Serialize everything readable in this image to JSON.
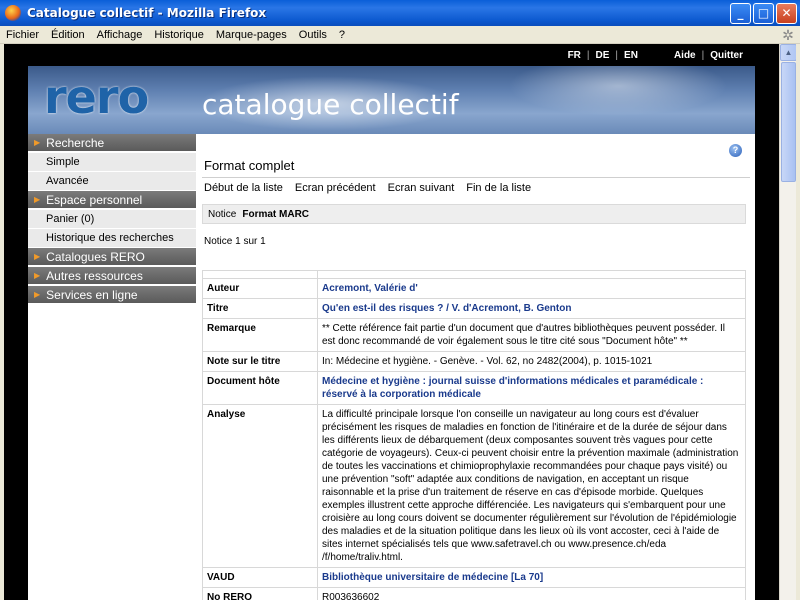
{
  "window": {
    "title": "Catalogue collectif - Mozilla Firefox",
    "min": "_",
    "max": "□",
    "close": "✕"
  },
  "menubar": [
    "Fichier",
    "Édition",
    "Affichage",
    "Historique",
    "Marque-pages",
    "Outils",
    "?"
  ],
  "topbar": {
    "lang_fr": "FR",
    "lang_de": "DE",
    "lang_en": "EN",
    "sep": "|",
    "help": "Aide",
    "quit": "Quitter"
  },
  "banner": {
    "logo": "rero",
    "subtitle": "catalogue collectif"
  },
  "sidebar": {
    "recherche": "Recherche",
    "simple": "Simple",
    "avancee": "Avancée",
    "espace": "Espace personnel",
    "panier": "Panier (0)",
    "historique": "Historique des recherches",
    "catalogues": "Catalogues RERO",
    "autres": "Autres ressources",
    "services": "Services en ligne"
  },
  "main": {
    "heading": "Format complet",
    "nav": {
      "first": "Début de la liste",
      "prev": "Ecran précédent",
      "next": "Ecran suivant",
      "last": "Fin de la liste"
    },
    "notice_label": "Notice",
    "notice_format": "Format MARC",
    "count": "Notice 1 sur 1",
    "help": "?"
  },
  "record": [
    {
      "label": "Auteur",
      "value": "Acremont, Valérie d'",
      "link": true
    },
    {
      "label": "Titre",
      "value": "Qu'en est-il des risques ? / V. d'Acremont, B. Genton",
      "link": true
    },
    {
      "label": "Remarque",
      "value": "** Cette référence fait partie d'un document que d'autres bibliothèques peuvent posséder. Il est donc recommandé de voir également sous le titre cité sous \"Document hôte\" **",
      "link": false
    },
    {
      "label": "Note sur le titre",
      "value": "In: Médecine et hygiène. - Genève. - Vol. 62, no 2482(2004), p. 1015-1021",
      "link": false
    },
    {
      "label": "Document hôte",
      "value": "Médecine et hygiène : journal suisse d'informations médicales et paramédicale : réservé à la corporation médicale",
      "link": true
    },
    {
      "label": "Analyse",
      "value": "La difficulté principale lorsque l'on conseille un navigateur au long cours est d'évaluer précisément les risques de maladies en fonction de l'itinéraire et de la durée de séjour dans les différents lieux de débarquement (deux composantes souvent très vagues pour cette catégorie de voyageurs). Ceux-ci peuvent choisir entre la prévention maximale (administration de toutes les vaccinations et chimioprophylaxie recommandées pour chaque pays visité) ou une prévention \"soft\" adaptée aux conditions de navigation, en acceptant un risque raisonnable et la prise d'un traitement de réserve en cas d'épisode morbide. Quelques exemples illustrent cette approche différenciée. Les navigateurs qui s'embarquent pour une croisière au long cours doivent se documenter régulièrement sur l'évolution de l'épidémiologie des maladies et de la situation politique dans les lieux où ils vont accoster, ceci à l'aide de sites internet spécialisés tels que www.safetravel.ch ou www.presence.ch/eda /f/home/traliv.html.",
      "link": false
    },
    {
      "label": "VAUD",
      "value": "Bibliothèque universitaire de médecine [La 70]",
      "link": true
    },
    {
      "label": "No RERO",
      "value": "R003636602",
      "link": false
    }
  ]
}
